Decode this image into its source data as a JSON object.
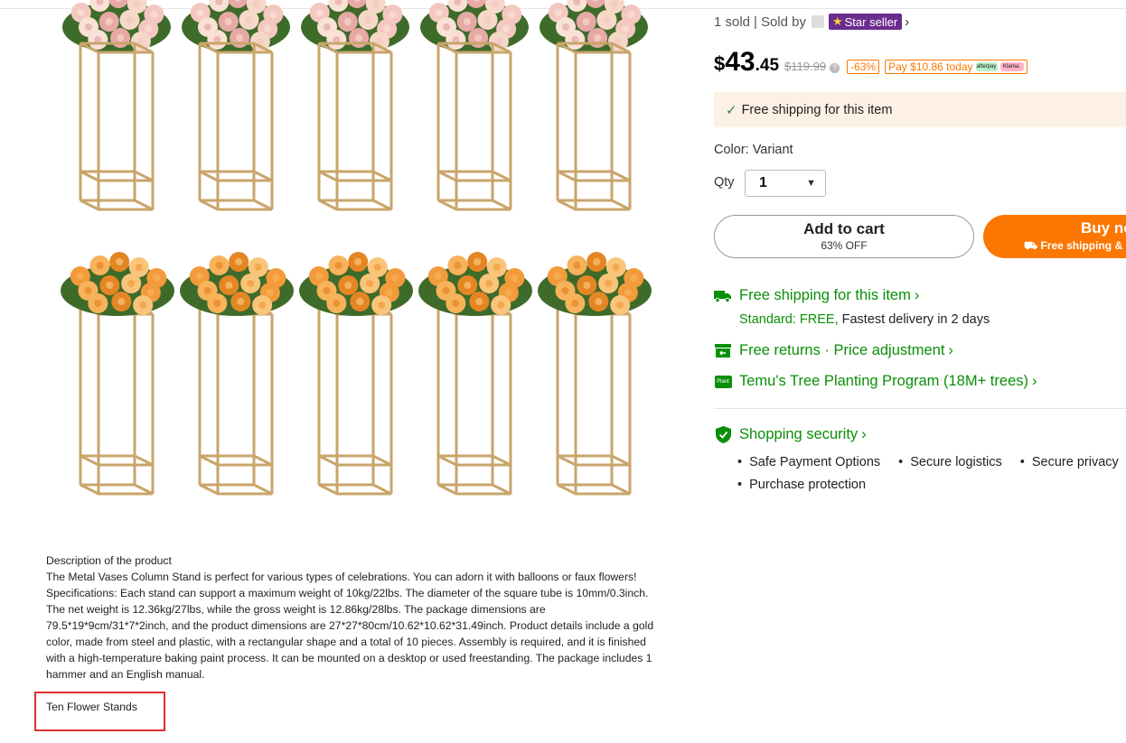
{
  "seller": {
    "sold_text": "1 sold",
    "separator": "|",
    "sold_by_label": "Sold by",
    "badge_label": "Star seller"
  },
  "price": {
    "dollar_sign": "$",
    "main": "43",
    "cents": ".45",
    "original": "$119.99",
    "discount_badge": "-63%",
    "pay_later": "Pay $10.86 today",
    "pay_logo_1": "afterpay",
    "pay_logo_2": "Klarna."
  },
  "shipping_banner": {
    "text": "Free shipping for this item"
  },
  "variant": {
    "color_label": "Color: Variant",
    "qty_label": "Qty",
    "qty_value": "1"
  },
  "buttons": {
    "add_to_cart": "Add to cart",
    "add_to_cart_sub": "63% OFF",
    "buy_now": "Buy now",
    "buy_now_sub": "Free shipping & return"
  },
  "features": {
    "shipping": "Free shipping for this item",
    "shipping_standard": "Standard: FREE,",
    "shipping_delivery": "Fastest delivery in 2 days",
    "returns": "Free returns · Price adjustment",
    "tree": "Temu's Tree Planting Program (18M+ trees)",
    "tree_icon_text": "Plant",
    "security": "Shopping security"
  },
  "security_items": [
    "Safe Payment Options",
    "Secure logistics",
    "Secure privacy",
    "Purchase protection"
  ],
  "description": {
    "heading": "Description of the product",
    "p1": "The Metal Vases Column Stand is perfect for various types of celebrations. You can adorn it with balloons or faux flowers!",
    "p2": "Specifications: Each stand can support a maximum weight of 10kg/22lbs. The diameter of the square tube is 10mm/0.3inch. The net weight is 12.36kg/27lbs, while the gross weight is 12.86kg/28lbs. The package dimensions are 79.5*19*9cm/31*7*2inch, and the product dimensions are 27*27*80cm/10.62*10.62*31.49inch. Product details include a gold color, made from steel and plastic, with a rectangular shape and a total of 10 pieces. Assembly is required, and it is finished with a high-temperature baking paint process. It can be mounted on a desktop or used freestanding. The package includes 1 hammer and an English manual.",
    "title": "Ten Flower Stands"
  },
  "colors": {
    "accent_orange": "#fb7701",
    "green": "#0a8f08",
    "star_seller_purple": "#6b2c8f",
    "gold_frame": "#c9a56b"
  }
}
